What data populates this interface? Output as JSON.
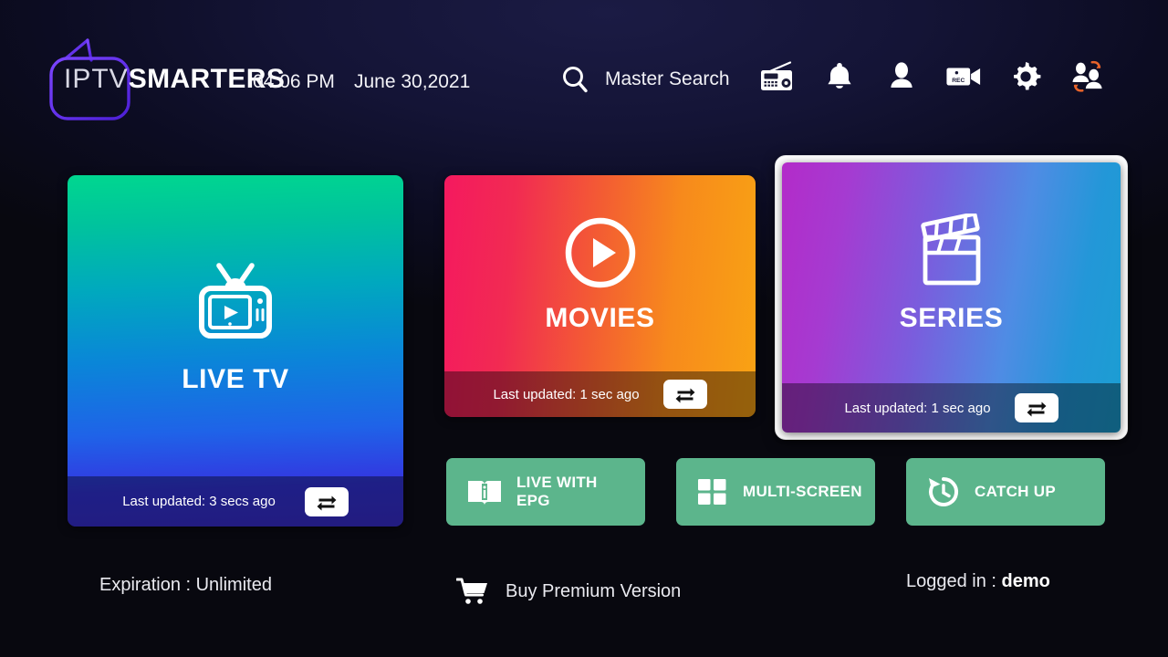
{
  "app": {
    "logo_primary": "IPTV",
    "logo_secondary": "SMARTERS",
    "logo_icon": "tv-outline-icon",
    "brand_purple": "#6a3df0"
  },
  "header": {
    "time": "04:06 PM",
    "date": "June 30,2021",
    "search": {
      "label": "Master Search",
      "icon": "search-icon"
    },
    "icons": [
      {
        "name": "radio-icon",
        "label": "Radio"
      },
      {
        "name": "bell-icon",
        "label": "Notifications"
      },
      {
        "name": "person-icon",
        "label": "Account"
      },
      {
        "name": "rec-camera-icon",
        "label": "REC"
      },
      {
        "name": "gear-icon",
        "label": "Settings"
      },
      {
        "name": "switch-user-icon",
        "label": "Switch User"
      }
    ]
  },
  "cards": [
    {
      "id": "live",
      "title": "LIVE TV",
      "icon": "retro-tv-play-icon",
      "last_updated": "Last updated: 3 secs ago",
      "refresh_icon": "repeat-arrows-icon",
      "gradient_from": "#00d78f",
      "gradient_to": "#3a2fd6",
      "focused": false
    },
    {
      "id": "movies",
      "title": "MOVIES",
      "icon": "play-circle-icon",
      "last_updated": "Last updated: 1 sec ago",
      "refresh_icon": "repeat-arrows-icon",
      "gradient_from": "#f4195f",
      "gradient_to": "#f9a313",
      "focused": false
    },
    {
      "id": "series",
      "title": "SERIES",
      "icon": "clapperboard-icon",
      "last_updated": "Last updated: 1 sec ago",
      "refresh_icon": "repeat-arrows-icon",
      "gradient_from": "#b32bc9",
      "gradient_to": "#1b9ed2",
      "focused": true,
      "focus_border_color": "#ffffff"
    }
  ],
  "quick_buttons": [
    {
      "id": "epg",
      "label": "LIVE WITH\nEPG",
      "label_line1": "LIVE WITH",
      "label_line2": "EPG",
      "icon": "book-info-icon",
      "color": "#5cb58c"
    },
    {
      "id": "multi",
      "label": "MULTI-SCREEN",
      "icon": "grid-4-icon",
      "color": "#5cb58c"
    },
    {
      "id": "catch",
      "label": "CATCH UP",
      "icon": "history-clock-icon",
      "color": "#5cb58c"
    }
  ],
  "footer": {
    "expiration": "Expiration : Unlimited",
    "buy": {
      "label": "Buy Premium Version",
      "icon": "shopping-cart-icon"
    },
    "login_prefix": "Logged in : ",
    "login_user": "demo"
  }
}
